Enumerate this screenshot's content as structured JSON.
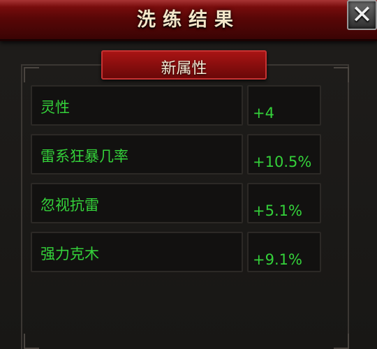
{
  "window": {
    "title": "洗练结果",
    "close_icon": "close-icon"
  },
  "section": {
    "label": "新属性"
  },
  "attributes": [
    {
      "name": "灵性",
      "value": "+4"
    },
    {
      "name": "雷系狂暴几率",
      "value": "+10.5%"
    },
    {
      "name": "忽视抗雷",
      "value": "+5.1%"
    },
    {
      "name": "强力克木",
      "value": "+9.1%"
    }
  ],
  "colors": {
    "title_bar": "#6a0808",
    "accent_text": "#34d13a",
    "panel_bg": "#1c1a18"
  }
}
